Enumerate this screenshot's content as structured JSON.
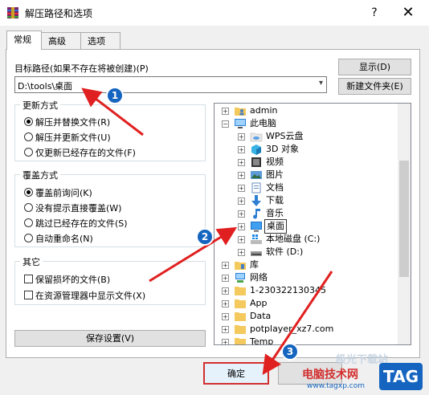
{
  "window": {
    "title": "解压路径和选项",
    "help": "?",
    "close": "✕"
  },
  "tabs": [
    {
      "label": "常规"
    },
    {
      "label": "高级"
    },
    {
      "label": "选项"
    }
  ],
  "target": {
    "label": "目标路径(如果不存在将被创建)(P)",
    "value": "D:\\tools\\桌面",
    "show_button": "显示(D)",
    "new_folder_button": "新建文件夹(E)"
  },
  "update_mode": {
    "title": "更新方式",
    "options": [
      "解压并替换文件(R)",
      "解压并更新文件(U)",
      "仅更新已经存在的文件(F)"
    ],
    "selected": 0
  },
  "overwrite_mode": {
    "title": "覆盖方式",
    "options": [
      "覆盖前询问(K)",
      "没有提示直接覆盖(W)",
      "跳过已经存在的文件(S)",
      "自动重命名(N)"
    ],
    "selected": 0
  },
  "other": {
    "title": "其它",
    "options": [
      "保留损坏的文件(B)",
      "在资源管理器中显示文件(X)"
    ]
  },
  "save_button": "保存设置(V)",
  "tree": [
    {
      "label": "admin",
      "icon": "user-folder-icon"
    },
    {
      "label": "此电脑",
      "icon": "computer-icon"
    },
    {
      "label": "WPS云盘",
      "icon": "cloud-folder-icon"
    },
    {
      "label": "3D 对象",
      "icon": "3d-objects-icon"
    },
    {
      "label": "视频",
      "icon": "video-folder-icon"
    },
    {
      "label": "图片",
      "icon": "pictures-folder-icon"
    },
    {
      "label": "文档",
      "icon": "documents-folder-icon"
    },
    {
      "label": "下载",
      "icon": "download-arrow-icon"
    },
    {
      "label": "音乐",
      "icon": "music-note-icon"
    },
    {
      "label": "桌面",
      "icon": "desktop-icon"
    },
    {
      "label": "本地磁盘 (C:)",
      "icon": "windows-drive-icon"
    },
    {
      "label": "软件 (D:)",
      "icon": "drive-icon"
    },
    {
      "label": "库",
      "icon": "library-folder-icon"
    },
    {
      "label": "网络",
      "icon": "network-icon"
    },
    {
      "label": "1-230322130345",
      "icon": "folder-icon"
    },
    {
      "label": "App",
      "icon": "folder-icon"
    },
    {
      "label": "Data",
      "icon": "folder-icon"
    },
    {
      "label": "potplayer_xz7.com",
      "icon": "folder-icon"
    },
    {
      "label": "Temp",
      "icon": "folder-icon"
    }
  ],
  "ok_button": "确定",
  "annotations": {
    "step1": "1",
    "step2": "2",
    "step3": "3",
    "arrow_color": "#e02020",
    "badge_color": "#1565c0"
  },
  "watermark": {
    "site_name": "电脑技术网",
    "url": "www.tagxp.com",
    "logo": "TAG",
    "faded_text": "极光下载站"
  }
}
